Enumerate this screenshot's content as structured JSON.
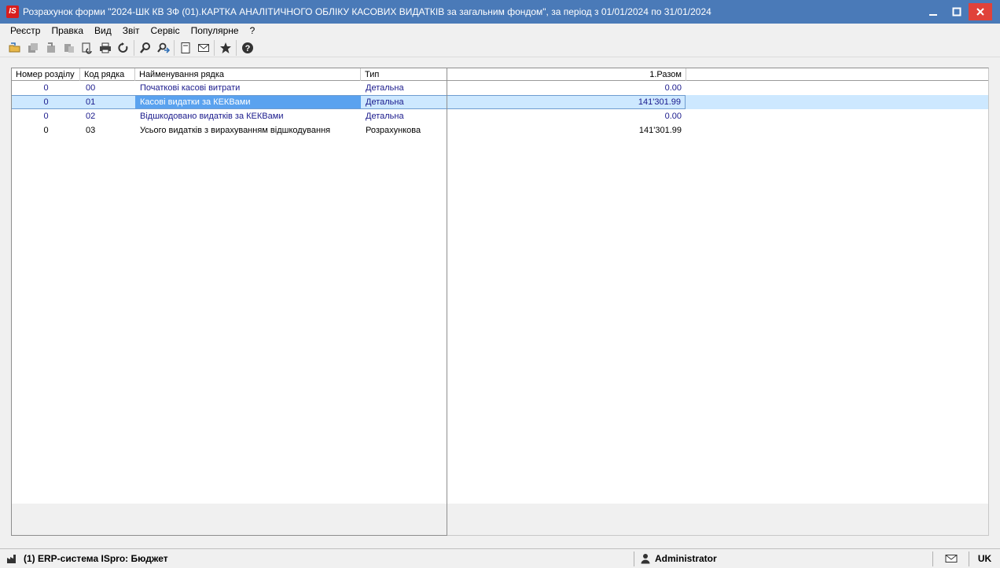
{
  "window": {
    "logo_text": "IS",
    "title": "Розрахунок форми \"2024-ШК КВ ЗФ (01).КАРТКА АНАЛІТИЧНОГО ОБЛІКУ КАСОВИХ ВИДАТКІВ  за загальним фондом\",  за період з  01/01/2024 по 31/01/2024",
    "minimize_icon": "minimize-icon",
    "maximize_icon": "maximize-icon",
    "close_icon": "close-icon"
  },
  "menu": {
    "items": [
      "Реєстр",
      "Правка",
      "Вид",
      "Звіт",
      "Сервіс",
      "Популярне",
      "?"
    ]
  },
  "toolbar": {
    "icons": [
      "open-folder-icon",
      "copy-icon",
      "move-icon",
      "paste-icon",
      "refresh-copy-icon",
      "print-icon",
      "reload-icon",
      "search-icon",
      "find-next-icon",
      "document-icon",
      "mail-icon",
      "star-icon",
      "help-icon"
    ]
  },
  "grid": {
    "columns": {
      "num": "Номер розділу",
      "code": "Код рядка",
      "name": "Найменування рядка",
      "type": "Тип",
      "sum": "1.Разом"
    },
    "rows": [
      {
        "num": "0",
        "code": "00",
        "name": "Початкові касові витрати",
        "type": "Детальна",
        "sum": "0.00"
      },
      {
        "num": "0",
        "code": "01",
        "name": "Касові видатки за КЕКВами",
        "type": "Детальна",
        "sum": "141'301.99"
      },
      {
        "num": "0",
        "code": "02",
        "name": "Відшкодовано видатків за КЕКВами",
        "type": "Детальна",
        "sum": "0.00"
      },
      {
        "num": "0",
        "code": "03",
        "name": "Усього видатків з вирахуванням відшкодування",
        "type": "Розрахункова",
        "sum": "141'301.99"
      }
    ],
    "selected_row": 1
  },
  "statusbar": {
    "system": "(1) ERP-система ISpro: Бюджет",
    "user": "Administrator",
    "lang": "UK"
  },
  "colors": {
    "titlebar": "#4a7ab8",
    "close_button": "#e0423a",
    "selection": "#cde8ff",
    "focus_cell": "#5aa2ef",
    "detail_text": "#1a1a8c"
  }
}
